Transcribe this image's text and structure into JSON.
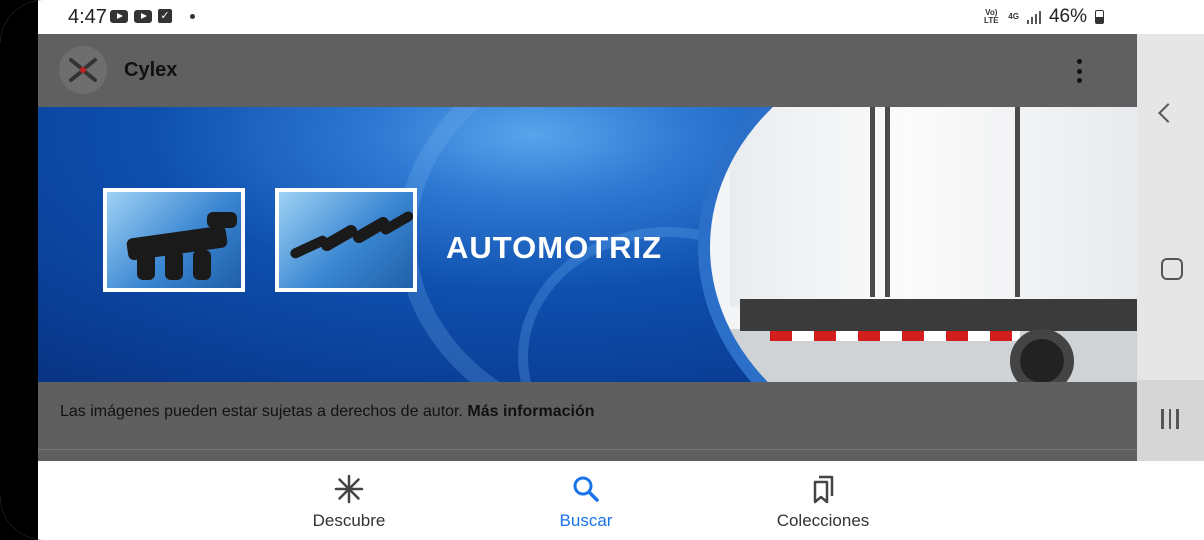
{
  "status_bar": {
    "time": "4:47",
    "network": "4G",
    "volte": "Vo) LTE",
    "battery": "46%",
    "icons": [
      "youtube-icon",
      "youtube-icon",
      "checkbox-icon",
      "dot-icon",
      "signal-icon",
      "battery-icon"
    ]
  },
  "viewer": {
    "site_name": "Cylex",
    "banner_title": "AUTOMOTRIZ",
    "credit_text": "Las imágenes pueden estar sujetas a derechos de autor. ",
    "credit_link": "Más información"
  },
  "bottom_nav": {
    "items": [
      {
        "label": "Descubre",
        "icon": "asterisk-icon",
        "active": false
      },
      {
        "label": "Buscar",
        "icon": "search-icon",
        "active": true
      },
      {
        "label": "Colecciones",
        "icon": "bookmarks-icon",
        "active": false
      }
    ]
  },
  "colors": {
    "accent": "#1a73e8",
    "overlay": "#5f5f5f",
    "banner_blue": "#0d47a8"
  }
}
